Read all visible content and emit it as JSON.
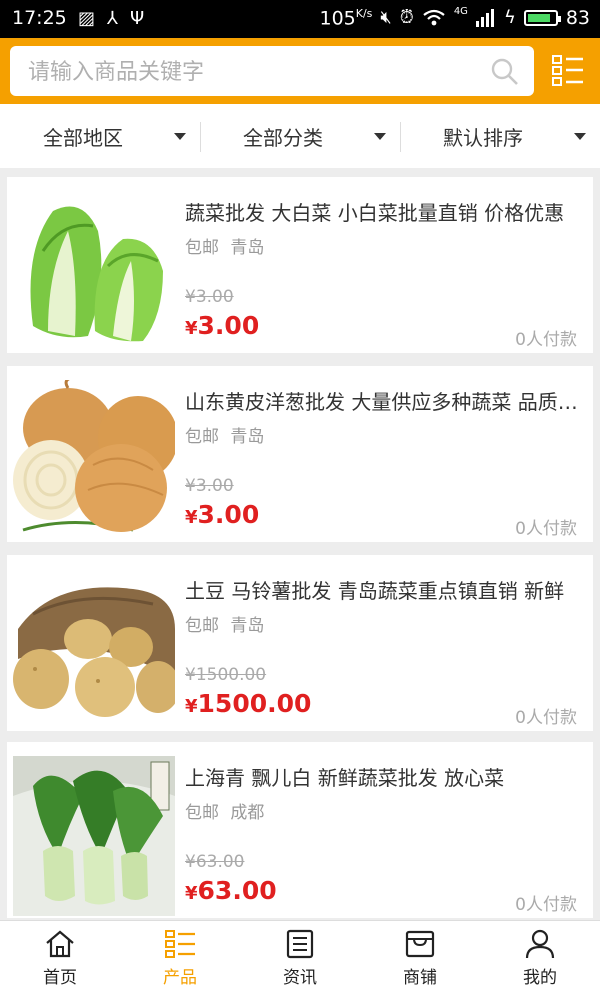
{
  "status_bar": {
    "time": "17:25",
    "speed": "105",
    "speed_unit": "K/s",
    "network": "4G",
    "battery_level": "83"
  },
  "search": {
    "placeholder": "请输入商品关键字"
  },
  "filters": [
    {
      "label": "全部地区"
    },
    {
      "label": "全部分类"
    },
    {
      "label": "默认排序"
    }
  ],
  "products": [
    {
      "title": "蔬菜批发 大白菜 小白菜批量直销 价格优惠",
      "shipping": "包邮",
      "location": "青岛",
      "original_price": "¥3.00",
      "currency": "¥",
      "price": "3.00",
      "paid": "0人付款",
      "image": "napa-cabbage"
    },
    {
      "title": "山东黄皮洋葱批发 大量供应多种蔬菜 品质保证",
      "shipping": "包邮",
      "location": "青岛",
      "original_price": "¥3.00",
      "currency": "¥",
      "price": "3.00",
      "paid": "0人付款",
      "image": "onions"
    },
    {
      "title": "土豆 马铃薯批发 青岛蔬菜重点镇直销 新鲜",
      "shipping": "包邮",
      "location": "青岛",
      "original_price": "¥1500.00",
      "currency": "¥",
      "price": "1500.00",
      "paid": "0人付款",
      "image": "potatoes"
    },
    {
      "title": "上海青 飘儿白 新鲜蔬菜批发 放心菜",
      "shipping": "包邮",
      "location": "成都",
      "original_price": "¥63.00",
      "currency": "¥",
      "price": "63.00",
      "paid": "0人付款",
      "image": "bok-choy"
    }
  ],
  "tabs": [
    {
      "label": "首页",
      "icon": "home-icon"
    },
    {
      "label": "产品",
      "icon": "product-list-icon",
      "active": true
    },
    {
      "label": "资讯",
      "icon": "news-icon"
    },
    {
      "label": "商铺",
      "icon": "shop-icon"
    },
    {
      "label": "我的",
      "icon": "user-icon"
    }
  ],
  "colors": {
    "accent": "#f5a000",
    "price": "#e02020",
    "background": "#ededed"
  }
}
